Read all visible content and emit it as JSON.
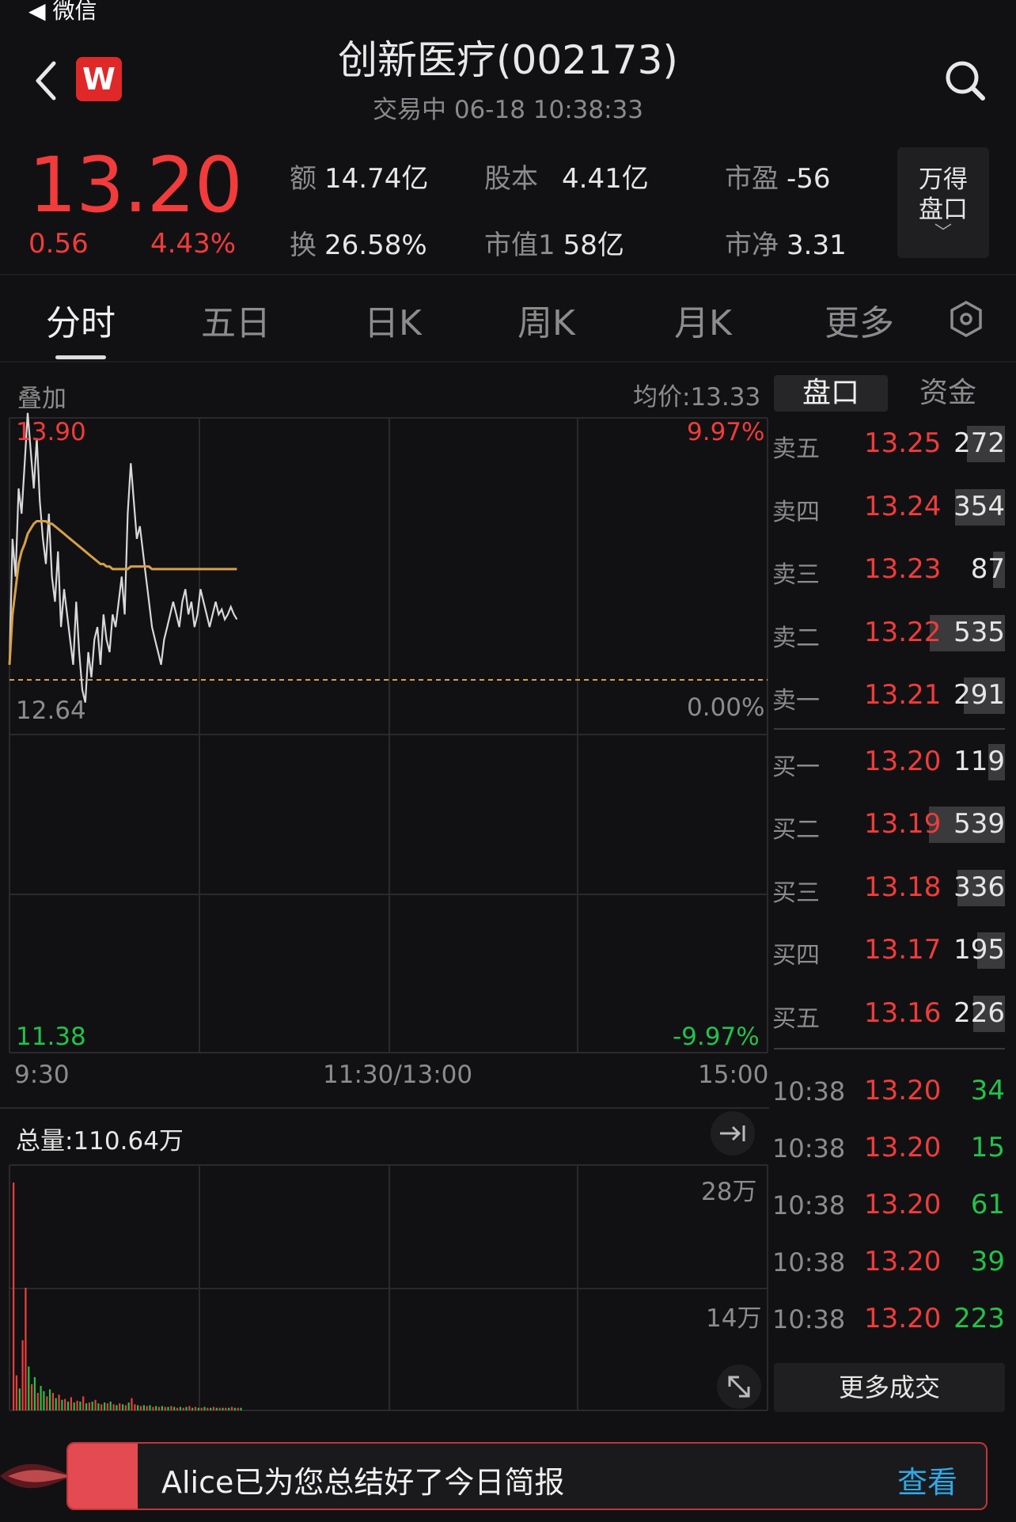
{
  "status": {
    "back_app": "微信"
  },
  "header": {
    "title": "创新医疗(002173)",
    "subtitle": "交易中  06-18 10:38:33"
  },
  "quote": {
    "price": "13.20",
    "change": "0.56",
    "change_pct": "4.43%",
    "fields": [
      {
        "label": "额",
        "value": "14.74亿"
      },
      {
        "label": "股本",
        "value": "4.41亿"
      },
      {
        "label": "市盈",
        "value": "-56"
      },
      {
        "label": "换",
        "value": "26.58%"
      },
      {
        "label": "市值1",
        "value": "58亿"
      },
      {
        "label": "市净",
        "value": "3.31"
      }
    ],
    "wande_line1": "万得",
    "wande_line2": "盘口"
  },
  "tabs": [
    "分时",
    "五日",
    "日K",
    "周K",
    "月K",
    "更多"
  ],
  "colors": {
    "up": "#f23b3b",
    "down": "#23c14a",
    "avg_line": "#d8a04a",
    "price_line": "#d8d8d8"
  },
  "chart": {
    "overlay_label": "叠加",
    "avg_price_label": "均价:13.33",
    "y_top": "13.90",
    "y_mid": "12.64",
    "y_bottom": "11.38",
    "pct_top": "9.97%",
    "pct_mid": "0.00%",
    "pct_bottom": "-9.97%",
    "x_start": "9:30",
    "x_mid": "11:30/13:00",
    "x_end": "15:00",
    "vol_total": "总量:110.64万",
    "vol_tick_top": "28万",
    "vol_tick_mid": "14万"
  },
  "chart_data": {
    "type": "line",
    "ylim": [
      11.38,
      13.9
    ],
    "prev_close": 12.64,
    "series": [
      {
        "name": "price",
        "values": [
          12.7,
          13.2,
          13.05,
          13.4,
          13.3,
          13.5,
          13.7,
          13.55,
          13.4,
          13.6,
          13.35,
          13.2,
          13.1,
          13.3,
          13.05,
          12.95,
          13.15,
          12.85,
          13.0,
          12.9,
          12.8,
          12.7,
          12.95,
          12.75,
          12.6,
          12.55,
          12.75,
          12.65,
          12.8,
          12.85,
          12.7,
          12.9,
          12.8,
          12.75,
          12.9,
          12.85,
          12.95,
          13.05,
          12.9,
          13.3,
          13.5,
          13.35,
          13.2,
          13.25,
          13.15,
          13.05,
          12.95,
          12.85,
          12.8,
          12.75,
          12.7,
          12.8,
          12.85,
          12.9,
          12.95,
          12.9,
          12.85,
          12.95,
          13.0,
          12.9,
          12.95,
          12.85,
          12.9,
          13.0,
          12.95,
          12.9,
          12.85,
          12.9,
          12.95,
          12.9,
          12.92,
          12.88,
          12.9,
          12.93,
          12.9,
          12.88
        ]
      },
      {
        "name": "avg",
        "values": [
          12.7,
          12.9,
          13.0,
          13.1,
          13.15,
          13.18,
          13.22,
          13.24,
          13.26,
          13.27,
          13.27,
          13.27,
          13.27,
          13.26,
          13.26,
          13.25,
          13.24,
          13.23,
          13.22,
          13.21,
          13.2,
          13.19,
          13.18,
          13.17,
          13.16,
          13.15,
          13.14,
          13.13,
          13.12,
          13.11,
          13.1,
          13.1,
          13.09,
          13.09,
          13.08,
          13.08,
          13.08,
          13.08,
          13.08,
          13.08,
          13.09,
          13.09,
          13.09,
          13.09,
          13.09,
          13.09,
          13.09,
          13.08,
          13.08,
          13.08,
          13.08,
          13.08,
          13.08,
          13.08,
          13.08,
          13.08,
          13.08,
          13.08,
          13.08,
          13.08,
          13.08,
          13.08,
          13.08,
          13.08,
          13.08,
          13.08,
          13.08,
          13.08,
          13.08,
          13.08,
          13.08,
          13.08,
          13.08,
          13.08,
          13.08,
          13.08
        ]
      }
    ],
    "volume": {
      "ylim": [
        0,
        280000
      ],
      "values": [
        260000,
        40000,
        25000,
        80000,
        140000,
        50000,
        30000,
        38000,
        20000,
        28000,
        22000,
        16000,
        24000,
        20000,
        14000,
        18000,
        12000,
        13000,
        10000,
        15000,
        9000,
        11000,
        10000,
        16000,
        8000,
        9000,
        10000,
        12000,
        8000,
        7000,
        9000,
        8000,
        10000,
        7000,
        6000,
        8000,
        7000,
        6000,
        9000,
        14000,
        7000,
        6000,
        5000,
        6000,
        5000,
        6000,
        4000,
        5000,
        4000,
        5000,
        4000,
        4000,
        5000,
        4000,
        3000,
        4000,
        3000,
        4000,
        5000,
        3000,
        4000,
        3000,
        3000,
        4000,
        3000,
        3000,
        4000,
        3000,
        3000,
        3000,
        3000,
        3000,
        4000,
        3000,
        3000,
        3000
      ],
      "up": [
        true,
        true,
        false,
        true,
        true,
        false,
        true,
        false,
        true,
        false,
        false,
        true,
        false,
        true,
        false,
        true,
        false,
        true,
        false,
        true,
        false,
        true,
        false,
        true,
        false,
        true,
        false,
        true,
        false,
        true,
        false,
        true,
        false,
        true,
        false,
        true,
        false,
        true,
        false,
        true,
        true,
        false,
        true,
        false,
        true,
        false,
        true,
        false,
        true,
        false,
        true,
        false,
        true,
        false,
        true,
        false,
        true,
        false,
        true,
        false,
        true,
        false,
        true,
        false,
        true,
        false,
        true,
        false,
        true,
        false,
        true,
        false,
        true,
        false,
        true,
        false
      ]
    }
  },
  "orderbook": {
    "tab_pankou": "盘口",
    "tab_zijin": "资金",
    "asks": [
      {
        "label": "卖五",
        "price": "13.25",
        "vol": "272",
        "ratio": 0.5
      },
      {
        "label": "卖四",
        "price": "13.24",
        "vol": "354",
        "ratio": 0.66
      },
      {
        "label": "卖三",
        "price": "13.23",
        "vol": "87",
        "ratio": 0.16
      },
      {
        "label": "卖二",
        "price": "13.22",
        "vol": "535",
        "ratio": 0.99
      },
      {
        "label": "卖一",
        "price": "13.21",
        "vol": "291",
        "ratio": 0.54
      }
    ],
    "bids": [
      {
        "label": "买一",
        "price": "13.20",
        "vol": "119",
        "ratio": 0.22
      },
      {
        "label": "买二",
        "price": "13.19",
        "vol": "539",
        "ratio": 1.0
      },
      {
        "label": "买三",
        "price": "13.18",
        "vol": "336",
        "ratio": 0.62
      },
      {
        "label": "买四",
        "price": "13.17",
        "vol": "195",
        "ratio": 0.36
      },
      {
        "label": "买五",
        "price": "13.16",
        "vol": "226",
        "ratio": 0.42
      }
    ]
  },
  "trades": [
    {
      "time": "10:38",
      "price": "13.20",
      "vol": "34"
    },
    {
      "time": "10:38",
      "price": "13.20",
      "vol": "15"
    },
    {
      "time": "10:38",
      "price": "13.20",
      "vol": "61"
    },
    {
      "time": "10:38",
      "price": "13.20",
      "vol": "39"
    },
    {
      "time": "10:38",
      "price": "13.20",
      "vol": "223"
    }
  ],
  "more_trades": "更多成交",
  "banner": {
    "text": "Alice已为您总结好了今日简报",
    "button": "查看"
  }
}
